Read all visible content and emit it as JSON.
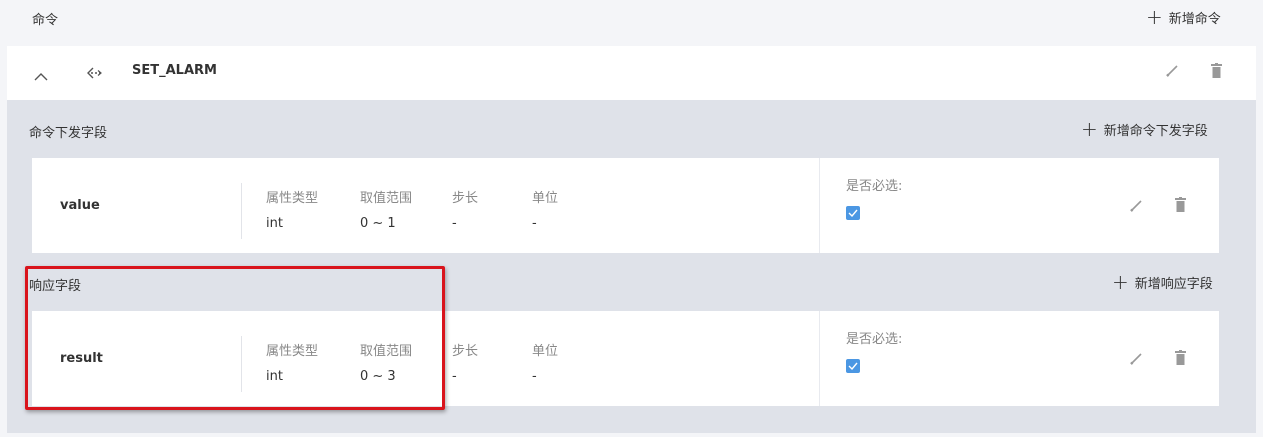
{
  "header": {
    "title": "命令",
    "add_command_label": "新增命令"
  },
  "command": {
    "name": "SET_ALARM"
  },
  "request_section": {
    "title": "命令下发字段",
    "add_label": "新增命令下发字段",
    "fields": [
      {
        "name": "value",
        "type_label": "属性类型",
        "type_value": "int",
        "range_label": "取值范围",
        "range_value": "0 ~ 1",
        "step_label": "步长",
        "step_value": "-",
        "unit_label": "单位",
        "unit_value": "-",
        "required_label": "是否必选:",
        "required": true
      }
    ]
  },
  "response_section": {
    "title": "响应字段",
    "add_label": "新增响应字段",
    "fields": [
      {
        "name": "result",
        "type_label": "属性类型",
        "type_value": "int",
        "range_label": "取值范围",
        "range_value": "0 ~ 3",
        "step_label": "步长",
        "step_value": "-",
        "unit_label": "单位",
        "unit_value": "-",
        "required_label": "是否必选:",
        "required": true
      }
    ]
  },
  "colors": {
    "highlight_border": "#d9141c",
    "checkbox": "#4b97e3",
    "section_bg": "#dfe2e9"
  }
}
